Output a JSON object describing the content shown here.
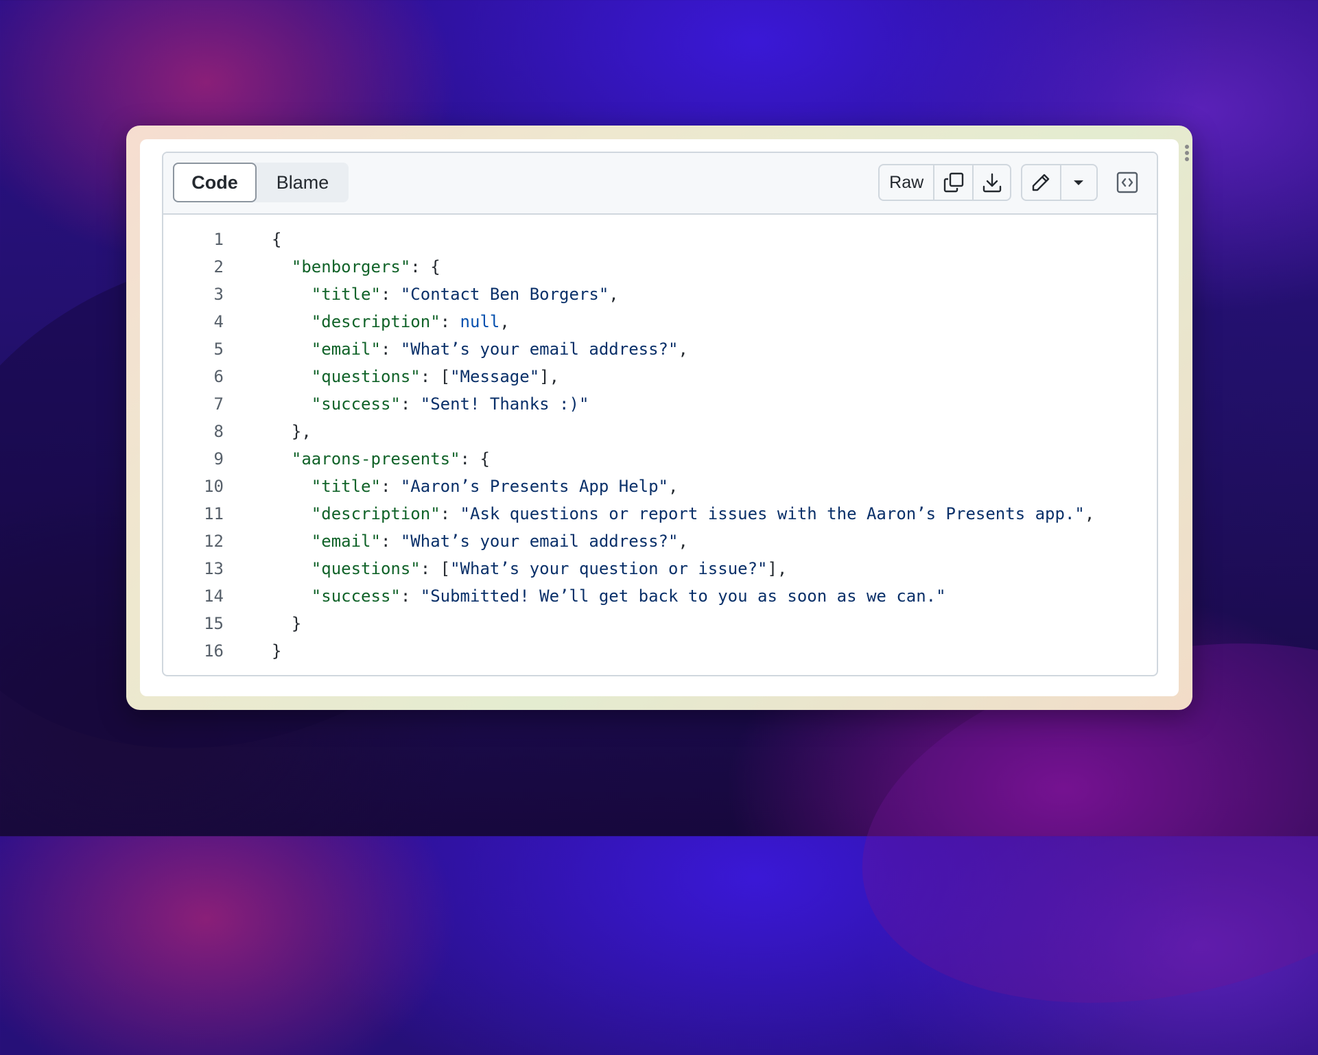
{
  "tabs": {
    "code": "Code",
    "blame": "Blame"
  },
  "toolbar": {
    "raw_label": "Raw",
    "icons": [
      "copy-icon",
      "download-icon",
      "pencil-icon",
      "triangle-down-icon",
      "code-square-icon"
    ]
  },
  "colors": {
    "key": "#116329",
    "string": "#0a3069",
    "literal": "#0550ae",
    "line_number": "#57606a"
  },
  "code_lines": [
    {
      "n": "1",
      "i": 0,
      "k": "",
      "rest": "{"
    },
    {
      "n": "2",
      "i": 1,
      "k": "\"benborgers\"",
      "rest": ": {"
    },
    {
      "n": "3",
      "i": 2,
      "k": "\"title\"",
      "rest": ": ",
      "s": "\"Contact Ben Borgers\"",
      "end": ","
    },
    {
      "n": "4",
      "i": 2,
      "k": "\"description\"",
      "rest": ": ",
      "lit": "null",
      "end": ","
    },
    {
      "n": "5",
      "i": 2,
      "k": "\"email\"",
      "rest": ": ",
      "s": "\"What’s your email address?\"",
      "end": ","
    },
    {
      "n": "6",
      "i": 2,
      "k": "\"questions\"",
      "rest": ": [",
      "s": "\"Message\"",
      "end": "],"
    },
    {
      "n": "7",
      "i": 2,
      "k": "\"success\"",
      "rest": ": ",
      "s": "\"Sent! Thanks :)\"",
      "end": ""
    },
    {
      "n": "8",
      "i": 1,
      "k": "",
      "rest": "},"
    },
    {
      "n": "9",
      "i": 1,
      "k": "\"aarons-presents\"",
      "rest": ": {"
    },
    {
      "n": "10",
      "i": 2,
      "k": "\"title\"",
      "rest": ": ",
      "s": "\"Aaron’s Presents App Help\"",
      "end": ","
    },
    {
      "n": "11",
      "i": 2,
      "k": "\"description\"",
      "rest": ": ",
      "s": "\"Ask questions or report issues with the Aaron’s Presents app.\"",
      "end": ","
    },
    {
      "n": "12",
      "i": 2,
      "k": "\"email\"",
      "rest": ": ",
      "s": "\"What’s your email address?\"",
      "end": ","
    },
    {
      "n": "13",
      "i": 2,
      "k": "\"questions\"",
      "rest": ": [",
      "s": "\"What’s your question or issue?\"",
      "end": "],"
    },
    {
      "n": "14",
      "i": 2,
      "k": "\"success\"",
      "rest": ": ",
      "s": "\"Submitted! We’ll get back to you as soon as we can.\"",
      "end": ""
    },
    {
      "n": "15",
      "i": 1,
      "k": "",
      "rest": "}"
    },
    {
      "n": "16",
      "i": 0,
      "k": "",
      "rest": "}"
    }
  ]
}
